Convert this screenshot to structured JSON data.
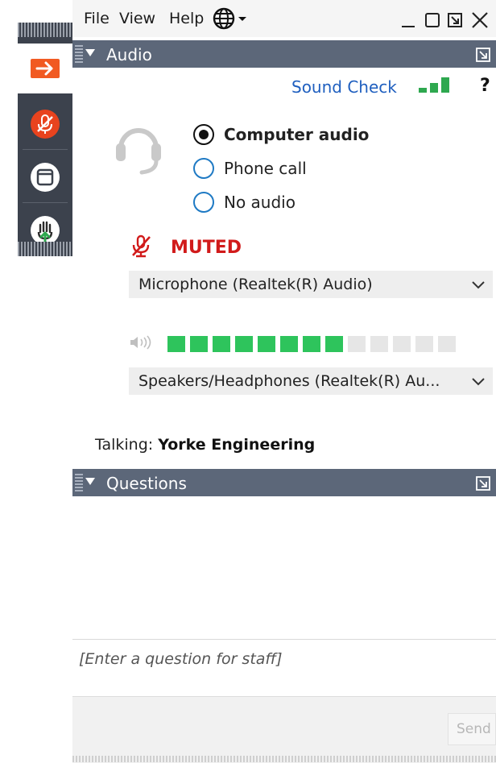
{
  "menu": {
    "file": "File",
    "view": "View",
    "help": "Help",
    "language_icon": "globe-icon"
  },
  "window_controls": [
    "minimize-icon",
    "maximize-icon",
    "restore-icon",
    "close-icon"
  ],
  "sidebar": {
    "items": [
      {
        "name": "expand",
        "icon": "arrow-right-icon",
        "color": "#f15a22"
      },
      {
        "name": "mute",
        "icon": "microphone-muted-icon",
        "color": "#e8431e"
      },
      {
        "name": "panel",
        "icon": "window-icon",
        "color": "#ffffff"
      },
      {
        "name": "raise-hand",
        "icon": "hand-icon",
        "color": "#2fa84f"
      }
    ]
  },
  "audio": {
    "title": "Audio",
    "sound_check": "Sound Check",
    "help": "?",
    "options": [
      {
        "label": "Computer audio",
        "selected": true
      },
      {
        "label": "Phone call",
        "selected": false
      },
      {
        "label": "No audio",
        "selected": false
      }
    ],
    "muted_label": "MUTED",
    "microphone": "Microphone (Realtek(R) Audio)",
    "speaker_level": {
      "filled": 8,
      "total": 13
    },
    "speakers": "Speakers/Headphones  (Realtek(R)  Au...",
    "talking_label": "Talking:",
    "talking_name": "Yorke Engineering"
  },
  "questions": {
    "title": "Questions",
    "placeholder": "[Enter a question for staff]",
    "send": "Send"
  },
  "colors": {
    "panel_bar": "#5c6779",
    "link_blue": "#1f5fbf",
    "muted_red": "#d11a1a",
    "meter_green": "#2ec45c",
    "radio_blue": "#1f7ac4"
  }
}
